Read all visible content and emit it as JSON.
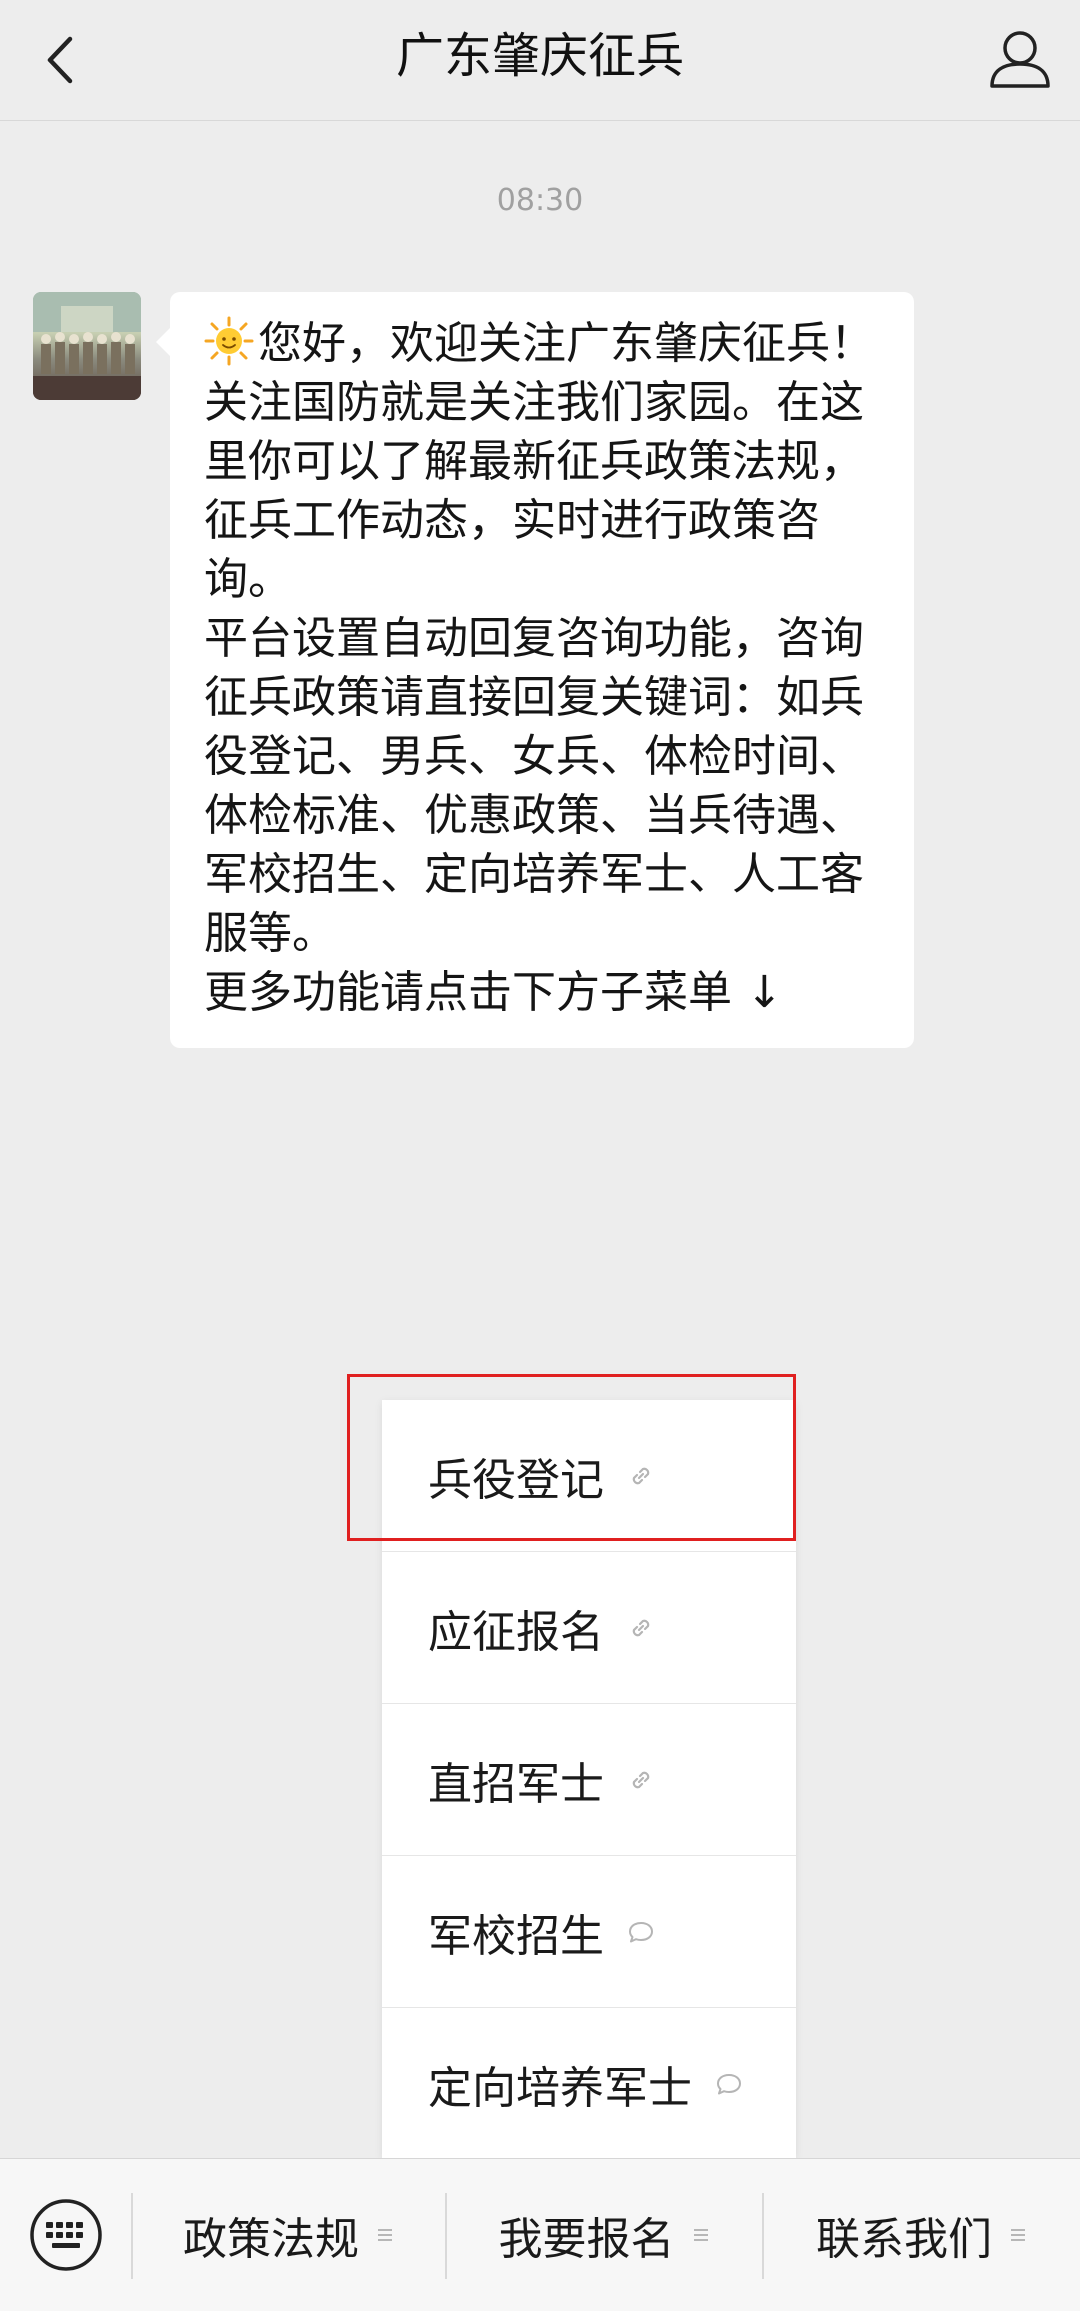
{
  "header": {
    "title": "广东肇庆征兵",
    "back_icon": "chevron-left-icon",
    "profile_icon": "person-icon"
  },
  "chat": {
    "timestamp": "08:30",
    "message": {
      "emoji": "sun-emoji-icon",
      "lines": [
        "您好，欢迎关注广东肇庆征兵！",
        "关注国防就是关注我们家园。在这",
        "里你可以了解最新征兵政策法规，",
        "征兵工作动态，实时进行政策咨",
        "询。",
        "平台设置自动回复咨询功能，咨询",
        "征兵政策请直接回复关键词：如兵",
        "役登记、男兵、女兵、体检时间、",
        "体检标准、优惠政策、当兵待遇、",
        "军校招生、定向培养军士、人工客",
        "服等。",
        "更多功能请点击下方子菜单 ↓"
      ]
    }
  },
  "submenu": {
    "items": [
      {
        "label": "兵役登记",
        "icon": "link-icon"
      },
      {
        "label": "应征报名",
        "icon": "link-icon"
      },
      {
        "label": "直招军士",
        "icon": "link-icon"
      },
      {
        "label": "军校招生",
        "icon": "chat-bubble-icon"
      },
      {
        "label": "定向培养军士",
        "icon": "chat-bubble-icon"
      }
    ]
  },
  "bottom_menu": {
    "keyboard_icon": "keyboard-icon",
    "tabs": [
      {
        "label": "政策法规",
        "icon": "menu-lines-icon"
      },
      {
        "label": "我要报名",
        "icon": "menu-lines-icon"
      },
      {
        "label": "联系我们",
        "icon": "menu-lines-icon"
      }
    ]
  },
  "colors": {
    "background": "#ededed",
    "bubble": "#ffffff",
    "highlight": "#e02020"
  }
}
